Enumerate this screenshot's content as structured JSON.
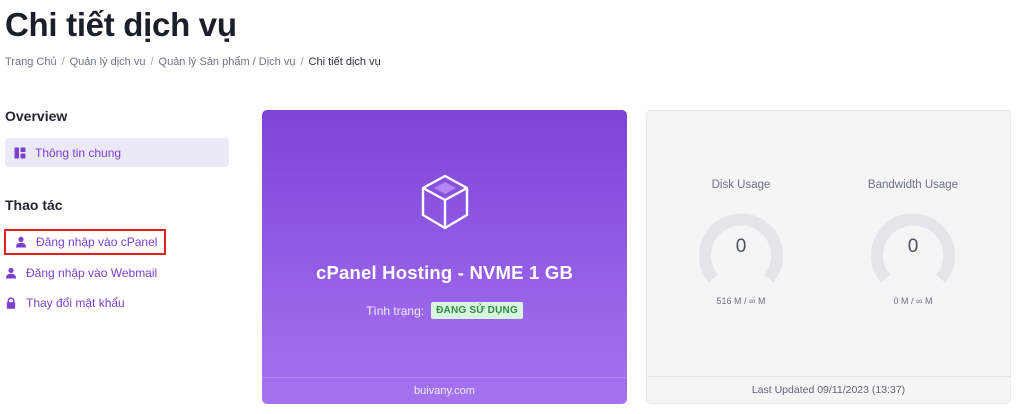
{
  "page": {
    "title": "Chi tiết dịch vụ"
  },
  "breadcrumb": [
    {
      "label": "Trang Chủ"
    },
    {
      "label": "Quản lý dịch vụ"
    },
    {
      "label": "Quản lý Sản phẩm / Dịch vụ"
    },
    {
      "label": "Chi tiết dịch vụ"
    }
  ],
  "breadcrumb_separator": "/",
  "sidebar": {
    "overview_heading": "Overview",
    "overview_items": [
      {
        "label": "Thông tin chung",
        "icon": "dashboard-icon"
      }
    ],
    "actions_heading": "Thao tác",
    "action_items": [
      {
        "label": "Đăng nhập vào cPanel",
        "icon": "user-icon"
      },
      {
        "label": "Đăng nhập vào Webmail",
        "icon": "user-icon"
      },
      {
        "label": "Thay đổi mật khẩu",
        "icon": "lock-icon"
      }
    ]
  },
  "product": {
    "icon": "cube-icon",
    "name": "cPanel Hosting - NVME 1 GB",
    "status_label": "Tình trạng:",
    "status_value": "ĐANG SỬ DỤNG",
    "domain": "buivany.com"
  },
  "usage": {
    "disk": {
      "title": "Disk Usage",
      "value": "0",
      "detail": "516 M / ∞ M"
    },
    "bandwidth": {
      "title": "Bandwidth Usage",
      "value": "0",
      "detail": "0 M / ∞ M"
    },
    "last_updated": "Last Updated 09/11/2023 (13:37)"
  },
  "colors": {
    "accent": "#7b3fd1",
    "card_gradient_top": "#7c44d6",
    "card_gradient_bottom": "#a473ef",
    "status_badge_bg": "#d9f5df",
    "status_badge_text": "#2e8c46",
    "highlight_border": "#e02020"
  }
}
